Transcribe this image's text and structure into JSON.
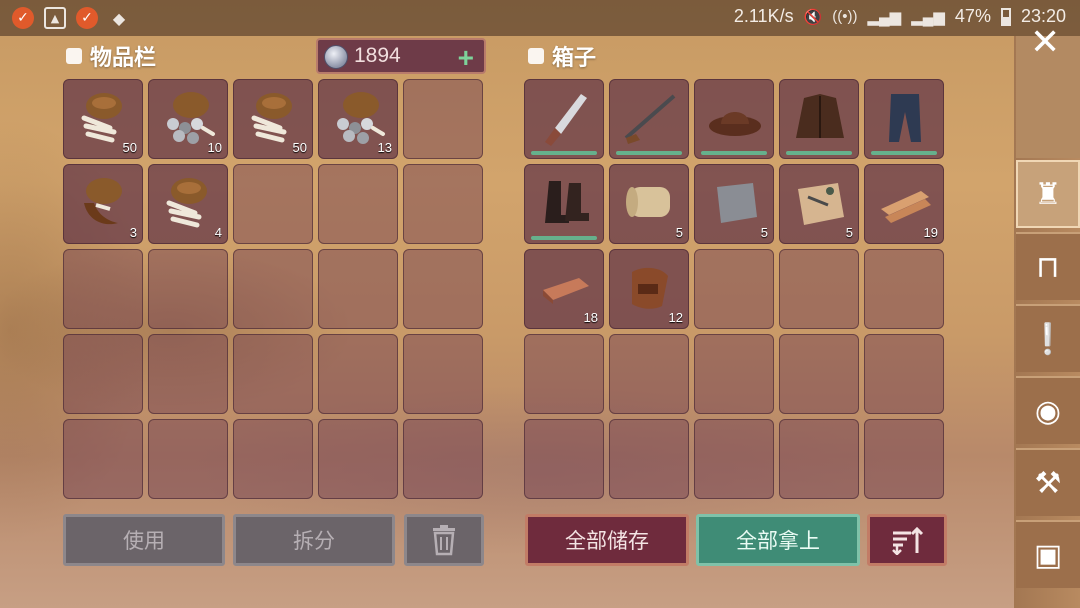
{
  "status_bar": {
    "net_speed": "2.11K/s",
    "battery": "47%",
    "time": "23:20"
  },
  "inventory": {
    "title": "物品栏",
    "currency": "1894",
    "slots": [
      {
        "item": "bones-bag",
        "qty": "50"
      },
      {
        "item": "bones-coins-bag",
        "qty": "10"
      },
      {
        "item": "bones-bag",
        "qty": "50"
      },
      {
        "item": "bones-coins-bag",
        "qty": "13"
      },
      {},
      {
        "item": "claw-bag",
        "qty": "3"
      },
      {
        "item": "bones-bag",
        "qty": "4"
      },
      {},
      {},
      {},
      {},
      {},
      {},
      {},
      {},
      {},
      {},
      {},
      {},
      {},
      {},
      {},
      {},
      {},
      {}
    ],
    "use_label": "使用",
    "split_label": "拆分"
  },
  "chest": {
    "title": "箱子",
    "slots": [
      {
        "item": "knife",
        "durability": true
      },
      {
        "item": "rifle",
        "durability": true
      },
      {
        "item": "hat",
        "durability": true
      },
      {
        "item": "jacket",
        "durability": true
      },
      {
        "item": "jeans",
        "durability": true
      },
      {
        "item": "boots",
        "durability": true
      },
      {
        "item": "cloth-roll",
        "qty": "5"
      },
      {
        "item": "metal-sheet",
        "qty": "5"
      },
      {
        "item": "blueprint-parts",
        "qty": "5"
      },
      {
        "item": "wood-planks",
        "qty": "19"
      },
      {
        "item": "copper-ingot",
        "qty": "18"
      },
      {
        "item": "leather",
        "qty": "12"
      },
      {},
      {},
      {},
      {},
      {},
      {},
      {},
      {},
      {},
      {},
      {},
      {},
      {}
    ],
    "store_all_label": "全部储存",
    "take_all_label": "全部拿上"
  },
  "sidebar": {
    "tabs": [
      "bag-icon",
      "crafting-table-icon",
      "quest-scroll-icon",
      "coins-icon",
      "anvil-icon",
      "backpack-icon"
    ]
  },
  "colors": {
    "slot": "#623446",
    "button_red": "#6f2b3d",
    "button_green": "#3f8c76",
    "accent_green": "#7dd39a"
  }
}
